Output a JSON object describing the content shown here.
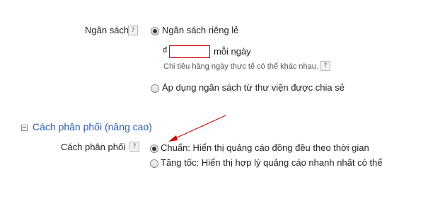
{
  "budget": {
    "label": "Ngân sách",
    "help": "?",
    "options": [
      {
        "label": "Ngân sách riêng lẻ",
        "selected": true
      },
      {
        "label": "Áp dụng ngân sách từ thư viện được chia sẻ",
        "selected": false
      }
    ],
    "currency_symbol": "đ",
    "amount_value": "",
    "per_day": "mỗi ngày",
    "note": "Chi tiêu hàng ngày thực tế có thể khác nhau.",
    "note_help": "?"
  },
  "delivery_section": {
    "title": "Cách phân phối (nâng cao)",
    "expanded": true
  },
  "delivery": {
    "label": "Cách phân phối",
    "help": "?",
    "options": [
      {
        "label": "Chuẩn: Hiển thị quảng cáo đồng đều theo thời gian",
        "selected": true
      },
      {
        "label": "Tăng tốc: Hiển thị hợp lý quảng cáo nhanh nhất có thể",
        "selected": false
      }
    ]
  },
  "annotation": {
    "arrow_color": "#cc0000"
  },
  "colors": {
    "link": "#2a5db0",
    "input_error_border": "#cc0000"
  }
}
